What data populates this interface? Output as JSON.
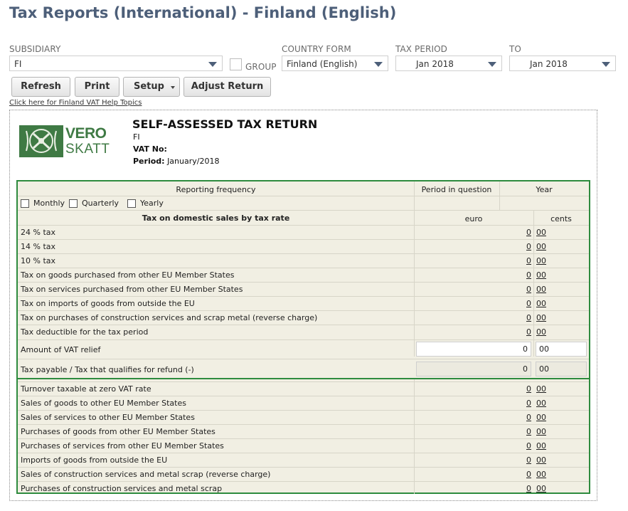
{
  "page": {
    "title": "Tax Reports (International) - Finland (English)"
  },
  "filters": {
    "subsidiary_label": "SUBSIDIARY",
    "subsidiary_value": "FI",
    "group_label": "GROUP",
    "country_form_label": "COUNTRY FORM",
    "country_form_value": "Finland (English)",
    "tax_period_label": "TAX PERIOD",
    "tax_period_value": "Jan 2018",
    "to_label": "TO",
    "to_value": "Jan 2018"
  },
  "toolbar": {
    "refresh_label": "Refresh",
    "print_label": "Print",
    "setup_label": "Setup",
    "adjust_label": "Adjust Return"
  },
  "help_link": "Click here for Finland VAT Help Topics",
  "logo": {
    "line1": "VERO",
    "line2": "SKATT"
  },
  "report": {
    "title": "SELF-ASSESSED TAX RETURN",
    "subsidiary": "FI",
    "vat_no_label": "VAT No:",
    "vat_no_value": "",
    "period_label": "Period:",
    "period_value": "January/2018"
  },
  "form": {
    "reporting_frequency": "Reporting frequency",
    "period_in_question": "Period in question",
    "year": "Year",
    "monthly": "Monthly",
    "quarterly": "Quarterly",
    "yearly": "Yearly",
    "domestic_header": "Tax on domestic sales by tax rate",
    "euro": "euro",
    "cents": "cents",
    "rows_top": [
      {
        "label": "24 % tax",
        "euro": "0",
        "cents": "00"
      },
      {
        "label": "14 % tax",
        "euro": "0",
        "cents": "00"
      },
      {
        "label": "10 % tax",
        "euro": "0",
        "cents": "00"
      },
      {
        "label": "Tax on goods purchased from other EU Member States",
        "euro": "0",
        "cents": "00"
      },
      {
        "label": "Tax on services purchased from other EU Member States",
        "euro": "0",
        "cents": "00"
      },
      {
        "label": "Tax on imports of goods from outside the EU",
        "euro": "0",
        "cents": "00"
      },
      {
        "label": "Tax on purchases of construction services and scrap metal (reverse charge)",
        "euro": "0",
        "cents": "00"
      },
      {
        "label": "Tax deductible for the tax period",
        "euro": "0",
        "cents": "00"
      }
    ],
    "vat_relief": {
      "label": "Amount of VAT relief",
      "euro": "0",
      "cents": "00"
    },
    "tax_payable": {
      "label": "Tax payable / Tax that qualifies for refund (-)",
      "euro": "0",
      "cents": "00"
    },
    "rows_bottom": [
      {
        "label": "Turnover taxable at zero VAT rate",
        "euro": "0",
        "cents": "00"
      },
      {
        "label": "Sales of goods to other EU Member States",
        "euro": "0",
        "cents": "00"
      },
      {
        "label": "Sales of services to other EU Member States",
        "euro": "0",
        "cents": "00"
      },
      {
        "label": "Purchases of goods from other EU Member States",
        "euro": "0",
        "cents": "00"
      },
      {
        "label": "Purchases of services from other EU Member States",
        "euro": "0",
        "cents": "00"
      },
      {
        "label": "Imports of goods from outside the EU",
        "euro": "0",
        "cents": "00"
      },
      {
        "label": "Sales of construction services and metal scrap (reverse charge)",
        "euro": "0",
        "cents": "00"
      },
      {
        "label": "Purchases of construction services and metal scrap",
        "euro": "0",
        "cents": "00"
      }
    ]
  }
}
